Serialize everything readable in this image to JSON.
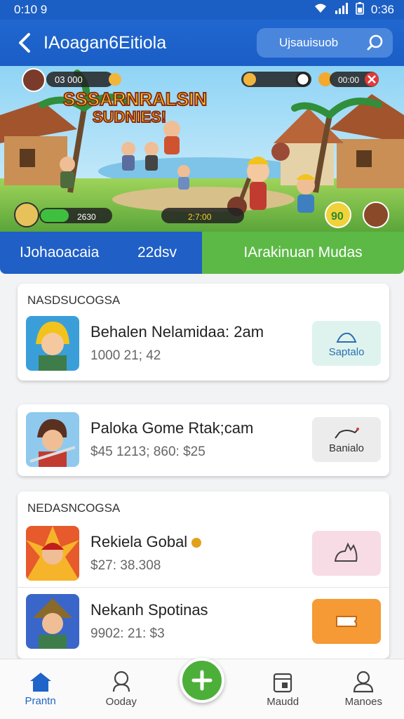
{
  "status_bar": {
    "time": "0:10 9",
    "clock_right": "0:36"
  },
  "app_bar": {
    "title": "IAoagan6Eitiola",
    "search_label": "Ujsauisuob"
  },
  "banner": {
    "logo_line1": "SSSARNRALSIN",
    "logo_line2": "SUDNIES!",
    "top_left_counter": "03 000",
    "top_right_counter": "00:00",
    "bottom_left_value": "2630",
    "bottom_center_value": "2:7:00",
    "badge_value": "90"
  },
  "tabs": {
    "left_label": "IJohaoacaia",
    "left_value": "22dsv",
    "right_label": "IArakinuan Mudas"
  },
  "section1": {
    "label": "NASDSUCOGSA",
    "items": [
      {
        "title": "Behalen Nelamidaa: 2am",
        "subtitle": "1000 21; 42",
        "action_label": "Saptalo",
        "action_color": "#dff3ee",
        "action_text_color": "#2b6fb3"
      }
    ]
  },
  "section2": {
    "items": [
      {
        "title": "Paloka Gome Rtak;cam",
        "subtitle": "$45 1213; 860: $25",
        "action_label": "Banialo",
        "action_color": "#ececec",
        "action_text_color": "#333333"
      }
    ]
  },
  "section3": {
    "label": "NEDASNCOGSA",
    "items": [
      {
        "title": "Rekiela Gobal",
        "subtitle": "$27: 38.308",
        "action_color": "#f7dce6"
      },
      {
        "title": "Nekanh Spotinas",
        "subtitle": "9902: 21: $3",
        "action_color": "#f59a35"
      }
    ]
  },
  "bottom_nav": {
    "items": [
      {
        "label": "Prantn",
        "icon": "home-icon",
        "active": true
      },
      {
        "label": "Ooday",
        "icon": "user-circle-icon",
        "active": false
      },
      {
        "label": "Maudd",
        "icon": "calendar-icon",
        "active": false
      },
      {
        "label": "Manoes",
        "icon": "person-icon",
        "active": false
      }
    ]
  },
  "colors": {
    "primary": "#1f5fc6",
    "accent": "#5cb946",
    "fab": "#4caf3a"
  }
}
